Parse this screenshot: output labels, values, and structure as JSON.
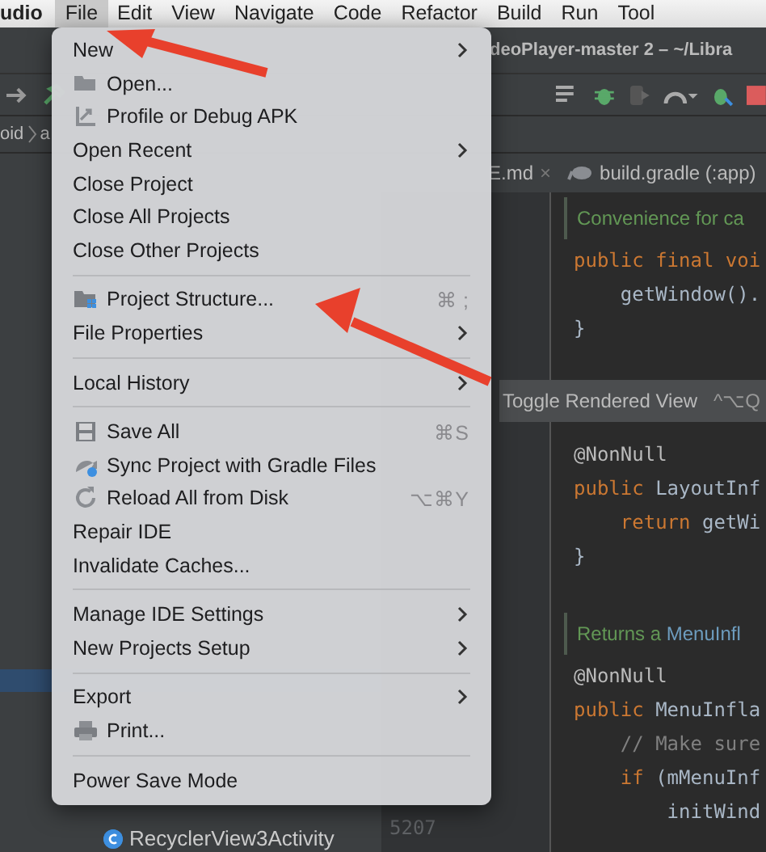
{
  "menu_bar": [
    {
      "label": "udio",
      "selected": false,
      "kind": "app"
    },
    {
      "label": "File",
      "selected": true,
      "kind": "menu"
    },
    {
      "label": "Edit",
      "selected": false,
      "kind": "menu"
    },
    {
      "label": "View",
      "selected": false,
      "kind": "menu"
    },
    {
      "label": "Navigate",
      "selected": false,
      "kind": "menu"
    },
    {
      "label": "Code",
      "selected": false,
      "kind": "menu"
    },
    {
      "label": "Refactor",
      "selected": false,
      "kind": "menu"
    },
    {
      "label": "Build",
      "selected": false,
      "kind": "menu"
    },
    {
      "label": "Run",
      "selected": false,
      "kind": "menu"
    },
    {
      "label": "Tool",
      "selected": false,
      "kind": "menu"
    }
  ],
  "window": {
    "title": "deoPlayer-master 2 – ~/Libra"
  },
  "breadcrumb": [
    "oid",
    "a"
  ],
  "editor_tabs": [
    {
      "label": "E.md",
      "close_mark": "×"
    },
    {
      "label": "build.gradle (:app)"
    }
  ],
  "file_menu": [
    {
      "kind": "item",
      "label": "New",
      "submenu": true
    },
    {
      "kind": "item",
      "label": "Open..."
    },
    {
      "kind": "item",
      "label": "Profile or Debug APK"
    },
    {
      "kind": "item",
      "label": "Open Recent",
      "submenu": true
    },
    {
      "kind": "item",
      "label": "Close Project"
    },
    {
      "kind": "item",
      "label": "Close All Projects"
    },
    {
      "kind": "item",
      "label": "Close Other Projects"
    },
    {
      "kind": "separator"
    },
    {
      "kind": "item",
      "label": "Project Structure...",
      "shortcut": "⌘ ;"
    },
    {
      "kind": "item",
      "label": "File Properties",
      "submenu": true
    },
    {
      "kind": "separator"
    },
    {
      "kind": "item",
      "label": "Local History",
      "submenu": true
    },
    {
      "kind": "separator"
    },
    {
      "kind": "item",
      "label": "Save All",
      "shortcut": "⌘S"
    },
    {
      "kind": "item",
      "label": "Sync Project with Gradle Files"
    },
    {
      "kind": "item",
      "label": "Reload All from Disk",
      "shortcut": "⌥⌘Y"
    },
    {
      "kind": "item",
      "label": "Repair IDE"
    },
    {
      "kind": "item",
      "label": "Invalidate Caches..."
    },
    {
      "kind": "separator"
    },
    {
      "kind": "item",
      "label": "Manage IDE Settings",
      "submenu": true
    },
    {
      "kind": "item",
      "label": "New Projects Setup",
      "submenu": true
    },
    {
      "kind": "separator"
    },
    {
      "kind": "item",
      "label": "Export",
      "submenu": true
    },
    {
      "kind": "item",
      "label": "Print..."
    },
    {
      "kind": "separator"
    },
    {
      "kind": "item",
      "label": "Power Save Mode"
    }
  ],
  "project_tree": {
    "file": "RecyclerView3Activity"
  },
  "gutter": {
    "line_number": "5207"
  },
  "code_lines": [
    {
      "kind": "comment",
      "tokens": [
        {
          "kind": "doc",
          "text": "Convenience for ca"
        }
      ]
    },
    {
      "kind": "code",
      "tokens": [
        {
          "kind": "keyword",
          "text": "public final "
        },
        {
          "kind": "keyword",
          "text": "voi"
        }
      ]
    },
    {
      "kind": "code",
      "tokens": [
        {
          "kind": "plain",
          "text": "    getWindow()."
        }
      ]
    },
    {
      "kind": "code",
      "tokens": [
        {
          "kind": "plain",
          "text": "}"
        }
      ]
    },
    {
      "kind": "blank"
    },
    {
      "kind": "toggle",
      "tokens": [
        {
          "kind": "plain",
          "text": "Toggle Rendered View"
        },
        {
          "kind": "dim",
          "text": "^⌥Q"
        }
      ]
    },
    {
      "kind": "code",
      "tokens": [
        {
          "kind": "annotation",
          "text": "@NonNull"
        }
      ]
    },
    {
      "kind": "code",
      "tokens": [
        {
          "kind": "keyword",
          "text": "public "
        },
        {
          "kind": "plain",
          "text": "LayoutInf"
        }
      ]
    },
    {
      "kind": "code",
      "tokens": [
        {
          "kind": "keyword",
          "text": "    return "
        },
        {
          "kind": "plain",
          "text": "getWi"
        }
      ]
    },
    {
      "kind": "code",
      "tokens": [
        {
          "kind": "plain",
          "text": "}"
        }
      ]
    },
    {
      "kind": "blank"
    },
    {
      "kind": "comment",
      "tokens": [
        {
          "kind": "doc",
          "text": "Returns a "
        },
        {
          "kind": "link",
          "text": "MenuInfl"
        }
      ]
    },
    {
      "kind": "code",
      "tokens": [
        {
          "kind": "annotation",
          "text": "@NonNull"
        }
      ]
    },
    {
      "kind": "code",
      "tokens": [
        {
          "kind": "keyword",
          "text": "public "
        },
        {
          "kind": "plain",
          "text": "MenuInfla"
        }
      ]
    },
    {
      "kind": "code",
      "tokens": [
        {
          "kind": "line_comment",
          "text": "    // Make sure"
        }
      ]
    },
    {
      "kind": "code",
      "tokens": [
        {
          "kind": "keyword",
          "text": "    if "
        },
        {
          "kind": "plain",
          "text": "(mMenuInf"
        }
      ]
    },
    {
      "kind": "code",
      "tokens": [
        {
          "kind": "plain",
          "text": "        initWind"
        }
      ]
    }
  ]
}
